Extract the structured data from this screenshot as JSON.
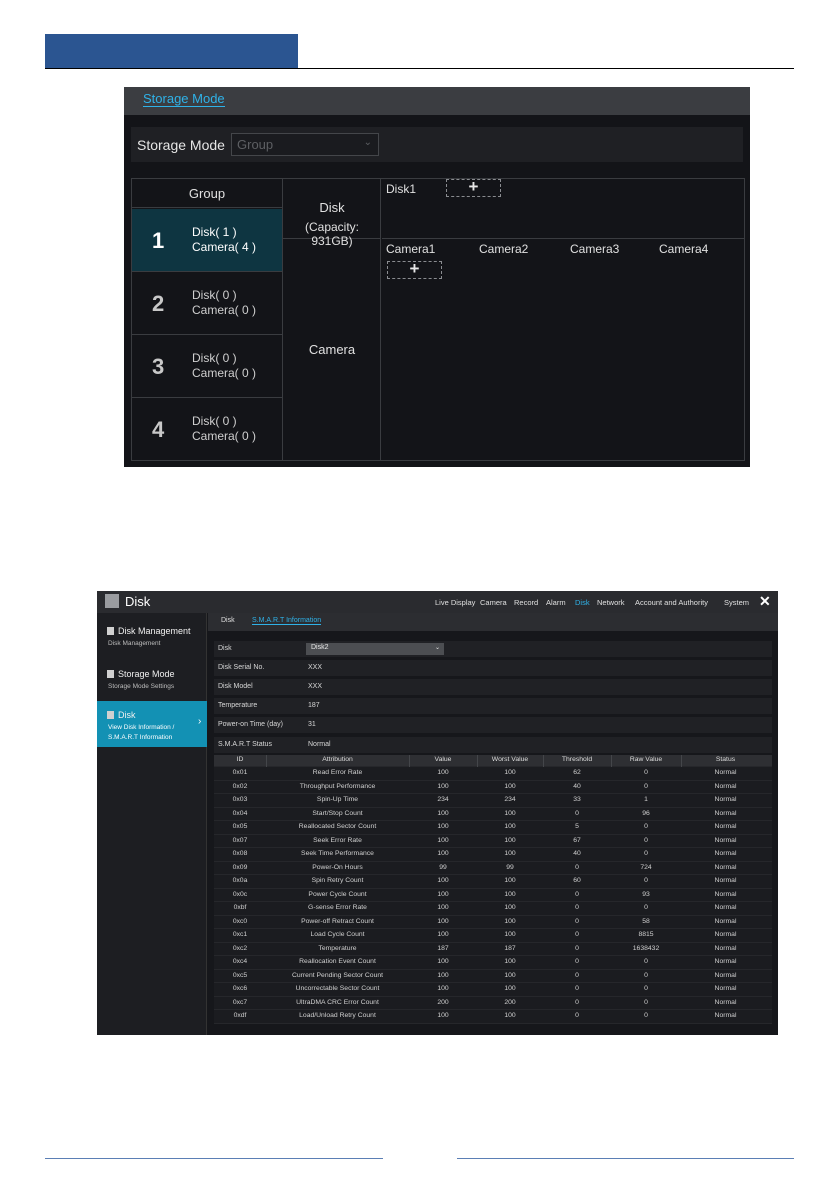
{
  "storage_mode_screen": {
    "title": "Storage Mode",
    "mode_label": "Storage Mode",
    "mode_value": "Group",
    "group_header": "Group",
    "groups": [
      {
        "num": "1",
        "disk": "Disk( 1 )",
        "camera": "Camera( 4 )"
      },
      {
        "num": "2",
        "disk": "Disk( 0 )",
        "camera": "Camera( 0 )"
      },
      {
        "num": "3",
        "disk": "Disk( 0 )",
        "camera": "Camera( 0 )"
      },
      {
        "num": "4",
        "disk": "Disk( 0 )",
        "camera": "Camera( 0 )"
      }
    ],
    "disk_label": "Disk",
    "capacity": "(Capacity: 931GB)",
    "camera_label": "Camera",
    "disk_name": "Disk1",
    "add_symbol": "+",
    "cameras": [
      "Camera1",
      "Camera2",
      "Camera3",
      "Camera4"
    ]
  },
  "disk_screen": {
    "title": "Disk",
    "nav": [
      "Live Display",
      "Camera",
      "Record",
      "Alarm",
      "Disk",
      "Network",
      "Account and Authority",
      "System"
    ],
    "active_nav": "Disk",
    "close": "✕",
    "sidebar": [
      {
        "title": "Disk Management",
        "sub1": "Disk Management",
        "sub2": ""
      },
      {
        "title": "Storage Mode",
        "sub1": "Storage Mode Settings",
        "sub2": ""
      },
      {
        "title": "Disk",
        "sub1": "View Disk Information /",
        "sub2": "S.M.A.R.T Information"
      }
    ],
    "tabs": [
      "Disk",
      "S.M.A.R.T Information"
    ],
    "info": {
      "disk_label": "Disk",
      "disk_value": "Disk2",
      "serial_label": "Disk Serial No.",
      "serial_value": "XXX",
      "model_label": "Disk Model",
      "model_value": "XXX",
      "temp_label": "Temperature",
      "temp_value": "187",
      "poweron_label": "Power-on Time (day)",
      "poweron_value": "31",
      "status_label": "S.M.A.R.T Status",
      "status_value": "Normal"
    },
    "table_headers": [
      "ID",
      "Attribution",
      "Value",
      "Worst Value",
      "Threshold",
      "Raw Value",
      "Status"
    ],
    "rows": [
      [
        "0x01",
        "Read Error Rate",
        "100",
        "100",
        "62",
        "0",
        "Normal"
      ],
      [
        "0x02",
        "Throughput Performance",
        "100",
        "100",
        "40",
        "0",
        "Normal"
      ],
      [
        "0x03",
        "Spin-Up Time",
        "234",
        "234",
        "33",
        "1",
        "Normal"
      ],
      [
        "0x04",
        "Start/Stop Count",
        "100",
        "100",
        "0",
        "96",
        "Normal"
      ],
      [
        "0x05",
        "Reallocated Sector Count",
        "100",
        "100",
        "5",
        "0",
        "Normal"
      ],
      [
        "0x07",
        "Seek Error Rate",
        "100",
        "100",
        "67",
        "0",
        "Normal"
      ],
      [
        "0x08",
        "Seek Time Performance",
        "100",
        "100",
        "40",
        "0",
        "Normal"
      ],
      [
        "0x09",
        "Power-On Hours",
        "99",
        "99",
        "0",
        "724",
        "Normal"
      ],
      [
        "0x0a",
        "Spin Retry Count",
        "100",
        "100",
        "60",
        "0",
        "Normal"
      ],
      [
        "0x0c",
        "Power Cycle Count",
        "100",
        "100",
        "0",
        "93",
        "Normal"
      ],
      [
        "0xbf",
        "G-sense Error Rate",
        "100",
        "100",
        "0",
        "0",
        "Normal"
      ],
      [
        "0xc0",
        "Power-off Retract Count",
        "100",
        "100",
        "0",
        "58",
        "Normal"
      ],
      [
        "0xc1",
        "Load Cycle Count",
        "100",
        "100",
        "0",
        "8815",
        "Normal"
      ],
      [
        "0xc2",
        "Temperature",
        "187",
        "187",
        "0",
        "1638432",
        "Normal"
      ],
      [
        "0xc4",
        "Reallocation Event Count",
        "100",
        "100",
        "0",
        "0",
        "Normal"
      ],
      [
        "0xc5",
        "Current Pending Sector Count",
        "100",
        "100",
        "0",
        "0",
        "Normal"
      ],
      [
        "0xc6",
        "Uncorrectable Sector Count",
        "100",
        "100",
        "0",
        "0",
        "Normal"
      ],
      [
        "0xc7",
        "UltraDMA CRC Error Count",
        "200",
        "200",
        "0",
        "0",
        "Normal"
      ],
      [
        "0xdf",
        "Load/Unload Retry Count",
        "100",
        "100",
        "0",
        "0",
        "Normal"
      ]
    ]
  }
}
